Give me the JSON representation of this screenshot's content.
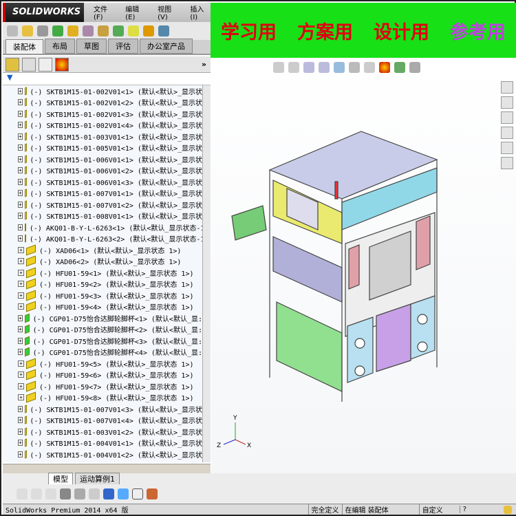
{
  "app": {
    "brand": "SOLIDWORKS",
    "menu": [
      "文件(F)",
      "编辑(E)",
      "视图(V)",
      "插入(I)"
    ]
  },
  "command_tabs": [
    "装配体",
    "布局",
    "草图",
    "评估",
    "办公室产品"
  ],
  "banner": [
    "学习用",
    "方案用",
    "设计用",
    "参考用"
  ],
  "banner_colors": {
    "bg": "#17e017",
    "text": "#e00010",
    "last": "#c040e0"
  },
  "tree": [
    {
      "t": "(-) SKTB1M15-01-002V01<1> (默认<默认>_显示状",
      "g": false
    },
    {
      "t": "(-) SKTB1M15-01-002V01<2> (默认<默认>_显示状",
      "g": false
    },
    {
      "t": "(-) SKTB1M15-01-002V01<3> (默认<默认>_显示状",
      "g": false
    },
    {
      "t": "(-) SKTB1M15-01-002V01<4> (默认<默认>_显示状",
      "g": false
    },
    {
      "t": "(-) SKTB1M15-01-003V01<1> (默认<默认>_显示状",
      "g": false
    },
    {
      "t": "(-) SKTB1M15-01-005V01<1> (默认<默认>_显示状",
      "g": false
    },
    {
      "t": "(-) SKTB1M15-01-006V01<1> (默认<默认>_显示状",
      "g": false
    },
    {
      "t": "(-) SKTB1M15-01-006V01<2> (默认<默认>_显示状",
      "g": false
    },
    {
      "t": "(-) SKTB1M15-01-006V01<3> (默认<默认>_显示状",
      "g": false
    },
    {
      "t": "(-) SKTB1M15-01-007V01<1> (默认<默认>_显示状",
      "g": false
    },
    {
      "t": "(-) SKTB1M15-01-007V01<2> (默认<默认>_显示状",
      "g": false
    },
    {
      "t": "(-) SKTB1M15-01-008V01<1> (默认<默认>_显示状",
      "g": false
    },
    {
      "t": "(-) AKQ01-B-Y-L-6263<1> (默认<默认_显示状态-1",
      "g": true
    },
    {
      "t": "(-) AKQ01-B-Y-L-6263<2> (默认<默认_显示状态-1",
      "g": true
    },
    {
      "t": "(-) XAD06<1> (默认<默认>_显示状态 1>)",
      "g": false
    },
    {
      "t": "(-) XAD06<2> (默认<默认>_显示状态 1>)",
      "g": false
    },
    {
      "t": "(-) HFU01-59<1> (默认<默认>_显示状态 1>)",
      "g": false
    },
    {
      "t": "(-) HFU01-59<2> (默认<默认>_显示状态 1>)",
      "g": false
    },
    {
      "t": "(-) HFU01-59<3> (默认<默认>_显示状态 1>)",
      "g": false
    },
    {
      "t": "(-) HFU01-59<4> (默认<默认>_显示状态 1>)",
      "g": false
    },
    {
      "t": "(-) CGP01-D75怡合达脚轮脚杯<1> (默认<默认_显:",
      "g": true
    },
    {
      "t": "(-) CGP01-D75怡合达脚轮脚杯<2> (默认<默认_显:",
      "g": true
    },
    {
      "t": "(-) CGP01-D75怡合达脚轮脚杯<3> (默认<默认_显:",
      "g": true
    },
    {
      "t": "(-) CGP01-D75怡合达脚轮脚杯<4> (默认<默认_显:",
      "g": true
    },
    {
      "t": "(-) HFU01-59<5> (默认<默认>_显示状态 1>)",
      "g": false
    },
    {
      "t": "(-) HFU01-59<6> (默认<默认>_显示状态 1>)",
      "g": false
    },
    {
      "t": "(-) HFU01-59<7> (默认<默认>_显示状态 1>)",
      "g": false
    },
    {
      "t": "(-) HFU01-59<8> (默认<默认>_显示状态 1>)",
      "g": false
    },
    {
      "t": "(-) SKTB1M15-01-007V01<3> (默认<默认>_显示状",
      "g": false
    },
    {
      "t": "(-) SKTB1M15-01-007V01<4> (默认<默认>_显示状",
      "g": false
    },
    {
      "t": "(-) SKTB1M15-01-003V01<2> (默认<默认>_显示状",
      "g": false
    },
    {
      "t": "(-) SKTB1M15-01-004V01<1> (默认<默认>_显示状",
      "g": false
    },
    {
      "t": "(-) SKTB1M15-01-004V01<2> (默认<默认>_显示状",
      "g": false
    }
  ],
  "bottom_tabs": [
    "模型",
    "运动算例1"
  ],
  "status": {
    "product": "SolidWorks Premium 2014 x64 版",
    "defined": "完全定义",
    "editing": "在编辑 装配体",
    "units": "自定义",
    "help": "?"
  },
  "triad": {
    "x": "X",
    "y": "Y",
    "z": "Z"
  }
}
